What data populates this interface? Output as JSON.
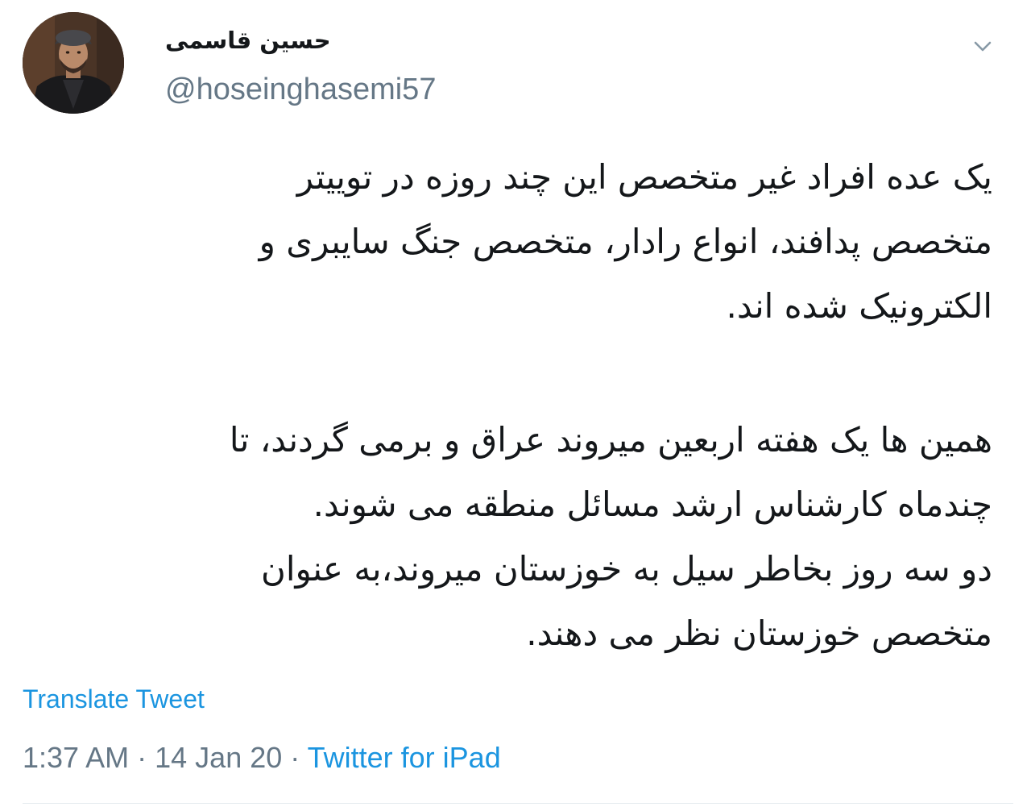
{
  "author": {
    "display_name": "حسین قاسمی",
    "handle": "@hoseinghasemi57",
    "avatar_icon": "profile-photo"
  },
  "menu_icon": "chevron-down-icon",
  "tweet": {
    "lines": [
      "یک عده افراد غیر متخصص این چند روزه در توییتر",
      "متخصص پدافند، انواع رادار، متخصص جنگ سایبری و",
      "الکترونیک شده اند.",
      "همین ها یک هفته اربعین میروند عراق و برمی گردند، تا",
      "چندماه کارشناس ارشد مسائل منطقه می شوند.",
      "دو سه روز بخاطر سیل به خوزستان میروند،به عنوان",
      "متخصص خوزستان نظر می دهند."
    ]
  },
  "translate_label": "Translate Tweet",
  "meta": {
    "time": "1:37 AM",
    "separator": "·",
    "date": "14 Jan 20",
    "source": "Twitter for iPad"
  },
  "colors": {
    "link": "#1b95e0",
    "secondary": "#657786",
    "text": "#14171a"
  }
}
